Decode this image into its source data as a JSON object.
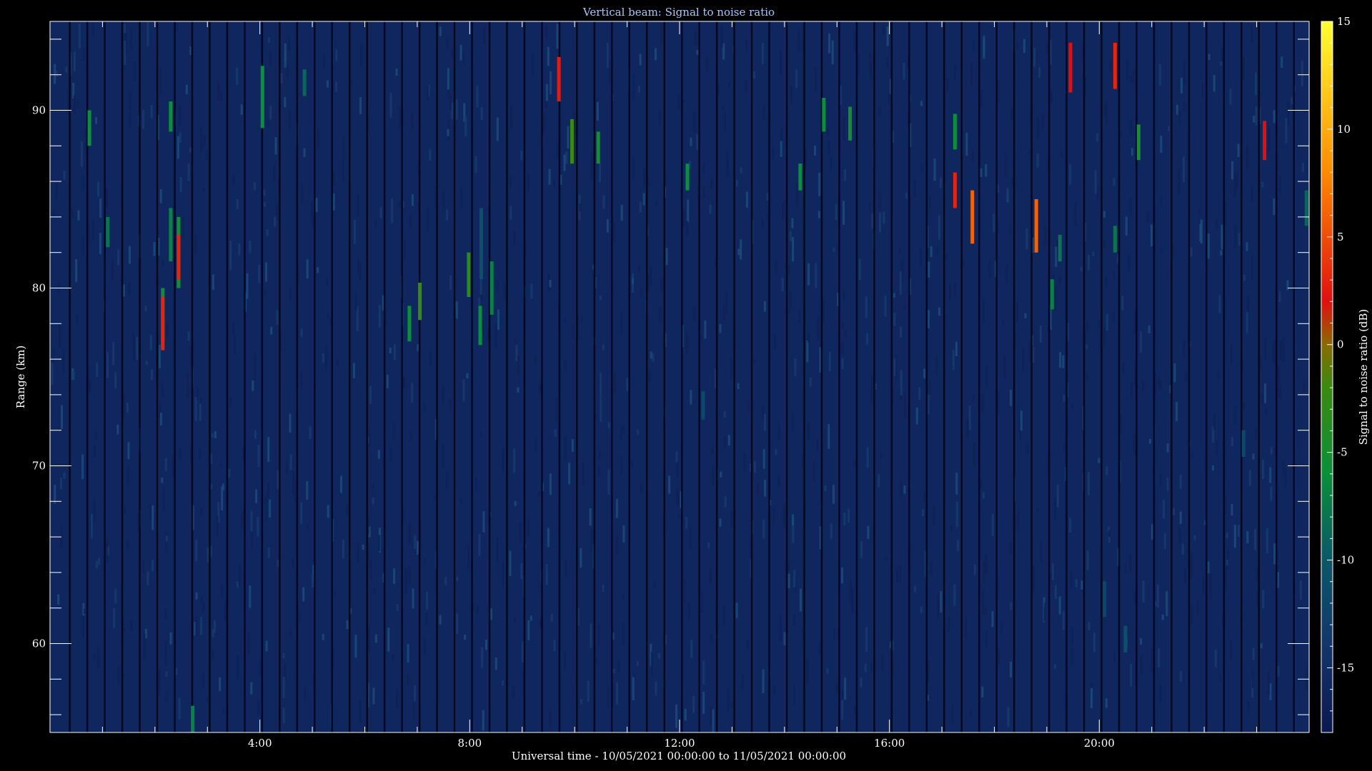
{
  "chart_data": {
    "type": "heatmap",
    "title": "Vertical beam: Signal to noise ratio",
    "xlabel": "Universal time - 10/05/2021 00:00:00 to 11/05/2021 00:00:00",
    "ylabel": "Range (km)",
    "xlim_hours": [
      0,
      24
    ],
    "ylim": [
      55,
      95
    ],
    "x_ticks": [
      {
        "hour": 4,
        "label": "4:00"
      },
      {
        "hour": 8,
        "label": "8:00"
      },
      {
        "hour": 12,
        "label": "12:00"
      },
      {
        "hour": 16,
        "label": "16:00"
      },
      {
        "hour": 20,
        "label": "20:00"
      }
    ],
    "y_ticks": [
      {
        "value": 60,
        "label": "60"
      },
      {
        "value": 70,
        "label": "70"
      },
      {
        "value": 80,
        "label": "80"
      },
      {
        "value": 90,
        "label": "90"
      }
    ],
    "colorbar": {
      "label": "Signal to noise ratio (dB)",
      "range": [
        -18,
        15
      ],
      "ticks": [
        {
          "value": 15,
          "label": "15"
        },
        {
          "value": 10,
          "label": "10"
        },
        {
          "value": 5,
          "label": "5"
        },
        {
          "value": 0,
          "label": "0"
        },
        {
          "value": -5,
          "label": "-5"
        },
        {
          "value": -10,
          "label": "-10"
        },
        {
          "value": -15,
          "label": "-15"
        }
      ],
      "stops": [
        {
          "value": -18,
          "color": "#0b1850"
        },
        {
          "value": -14,
          "color": "#13356b"
        },
        {
          "value": -10,
          "color": "#0a5868"
        },
        {
          "value": -6,
          "color": "#0a8f3a"
        },
        {
          "value": -2,
          "color": "#3a8a10"
        },
        {
          "value": 0,
          "color": "#8a6a00"
        },
        {
          "value": 2,
          "color": "#e01010"
        },
        {
          "value": 8,
          "color": "#ff8a00"
        },
        {
          "value": 15,
          "color": "#ffff30"
        }
      ]
    },
    "background_level_db": -16,
    "echoes": [
      {
        "t": 0.75,
        "r0": 88,
        "r1": 90,
        "snr": -6
      },
      {
        "t": 1.1,
        "r0": 82.3,
        "r1": 84,
        "snr": -8
      },
      {
        "t": 2.15,
        "r0": 77,
        "r1": 80,
        "snr": -6
      },
      {
        "t": 2.15,
        "r0": 76.5,
        "r1": 79.5,
        "snr": 3
      },
      {
        "t": 2.3,
        "r0": 88.8,
        "r1": 90.5,
        "snr": -6
      },
      {
        "t": 2.3,
        "r0": 81.5,
        "r1": 84.5,
        "snr": -7
      },
      {
        "t": 2.45,
        "r0": 80,
        "r1": 84,
        "snr": -5
      },
      {
        "t": 2.45,
        "r0": 80.5,
        "r1": 83,
        "snr": 3
      },
      {
        "t": 2.72,
        "r0": 55,
        "r1": 56.5,
        "snr": -7
      },
      {
        "t": 4.05,
        "r0": 89,
        "r1": 92.5,
        "snr": -6
      },
      {
        "t": 4.85,
        "r0": 90.8,
        "r1": 92.3,
        "snr": -9
      },
      {
        "t": 6.85,
        "r0": 77,
        "r1": 79,
        "snr": -6
      },
      {
        "t": 7.05,
        "r0": 78.2,
        "r1": 80.3,
        "snr": -2
      },
      {
        "t": 7.98,
        "r0": 79.5,
        "r1": 82,
        "snr": -3
      },
      {
        "t": 8.2,
        "r0": 76.8,
        "r1": 79,
        "snr": -6
      },
      {
        "t": 8.22,
        "r0": 80.5,
        "r1": 84.5,
        "snr": -11
      },
      {
        "t": 8.42,
        "r0": 78.5,
        "r1": 81.5,
        "snr": -7
      },
      {
        "t": 9.7,
        "r0": 90.5,
        "r1": 93,
        "snr": 2.5
      },
      {
        "t": 9.95,
        "r0": 87,
        "r1": 89.5,
        "snr": -2
      },
      {
        "t": 10.45,
        "r0": 87,
        "r1": 88.8,
        "snr": -5
      },
      {
        "t": 12.15,
        "r0": 85.5,
        "r1": 87,
        "snr": -6
      },
      {
        "t": 14.3,
        "r0": 85.5,
        "r1": 87,
        "snr": -6
      },
      {
        "t": 14.75,
        "r0": 88.8,
        "r1": 90.7,
        "snr": -6
      },
      {
        "t": 15.25,
        "r0": 88.3,
        "r1": 90.2,
        "snr": -5
      },
      {
        "t": 17.25,
        "r0": 87.8,
        "r1": 89.8,
        "snr": -6
      },
      {
        "t": 17.25,
        "r0": 84.5,
        "r1": 86.5,
        "snr": 3
      },
      {
        "t": 17.58,
        "r0": 82.5,
        "r1": 85.5,
        "snr": 6
      },
      {
        "t": 18.8,
        "r0": 82,
        "r1": 85,
        "snr": 6
      },
      {
        "t": 19.1,
        "r0": 78.8,
        "r1": 80.5,
        "snr": -7
      },
      {
        "t": 19.25,
        "r0": 81.5,
        "r1": 83,
        "snr": -8
      },
      {
        "t": 19.45,
        "r0": 91,
        "r1": 93.8,
        "snr": 2
      },
      {
        "t": 20.3,
        "r0": 91.2,
        "r1": 93.8,
        "snr": 3
      },
      {
        "t": 20.3,
        "r0": 82,
        "r1": 83.5,
        "snr": -8
      },
      {
        "t": 20.75,
        "r0": 87.2,
        "r1": 89.2,
        "snr": -5
      },
      {
        "t": 23.15,
        "r0": 87.2,
        "r1": 89.4,
        "snr": 2
      },
      {
        "t": 23.95,
        "r0": 83.5,
        "r1": 85.5,
        "snr": -9
      },
      {
        "t": 12.45,
        "r0": 72.6,
        "r1": 74.2,
        "snr": -12
      },
      {
        "t": 20.1,
        "r0": 61.5,
        "r1": 63.5,
        "snr": -12
      },
      {
        "t": 20.5,
        "r0": 59.5,
        "r1": 61,
        "snr": -11
      },
      {
        "t": 22.75,
        "r0": 70.5,
        "r1": 72,
        "snr": -12
      }
    ]
  }
}
